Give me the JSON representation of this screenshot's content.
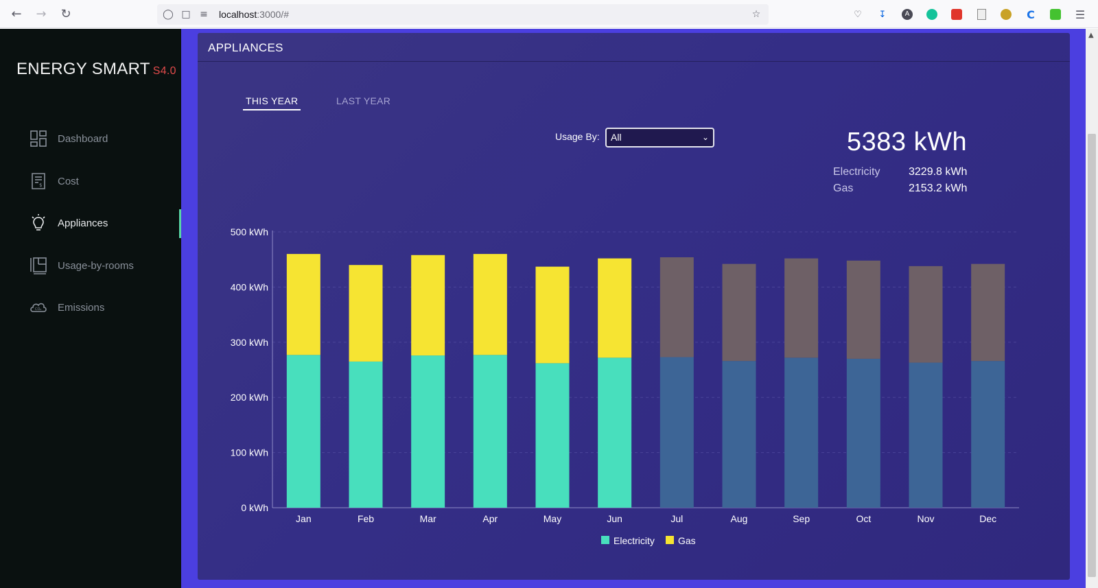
{
  "browser": {
    "url_host": "localhost",
    "url_rest": ":3000/#"
  },
  "sidebar": {
    "brand": "ENERGY SMART",
    "version": "S4.0",
    "items": [
      {
        "label": "Dashboard",
        "icon": "dashboard-icon"
      },
      {
        "label": "Cost",
        "icon": "receipt-icon"
      },
      {
        "label": "Appliances",
        "icon": "lightbulb-icon",
        "active": true
      },
      {
        "label": "Usage-by-rooms",
        "icon": "floorplan-icon"
      },
      {
        "label": "Emissions",
        "icon": "co2-cloud-icon"
      }
    ]
  },
  "panel": {
    "title": "APPLIANCES",
    "tabs": [
      "THIS YEAR",
      "LAST YEAR"
    ],
    "usage_label": "Usage By:",
    "usage_value": "All",
    "total": "5383 kWh",
    "breakdown": [
      {
        "name": "Electricity",
        "value": "3229.8 kWh"
      },
      {
        "name": "Gas",
        "value": "2153.2 kWh"
      }
    ]
  },
  "colors": {
    "electricity": "#48dfbd",
    "gas": "#f6e432",
    "electricity_forecast": "#3d6596",
    "gas_forecast": "#6e6066",
    "accent": "#58d6a6",
    "version": "#e24b4b"
  },
  "chart_data": {
    "type": "bar",
    "stacked": true,
    "categories": [
      "Jan",
      "Feb",
      "Mar",
      "Apr",
      "May",
      "Jun",
      "Jul",
      "Aug",
      "Sep",
      "Oct",
      "Nov",
      "Dec"
    ],
    "series": [
      {
        "name": "Electricity",
        "values": [
          277,
          265,
          276,
          277,
          262,
          272,
          273,
          266,
          272,
          270,
          263,
          266
        ]
      },
      {
        "name": "Gas",
        "values": [
          183,
          175,
          182,
          183,
          175,
          180,
          181,
          176,
          180,
          178,
          175,
          176
        ]
      }
    ],
    "forecast_from_index": 6,
    "yticks": [
      "0 kWh",
      "100 kWh",
      "200 kWh",
      "300 kWh",
      "400 kWh",
      "500 kWh"
    ],
    "ylim": [
      0,
      500
    ],
    "grid": true,
    "legend": "bottom"
  }
}
